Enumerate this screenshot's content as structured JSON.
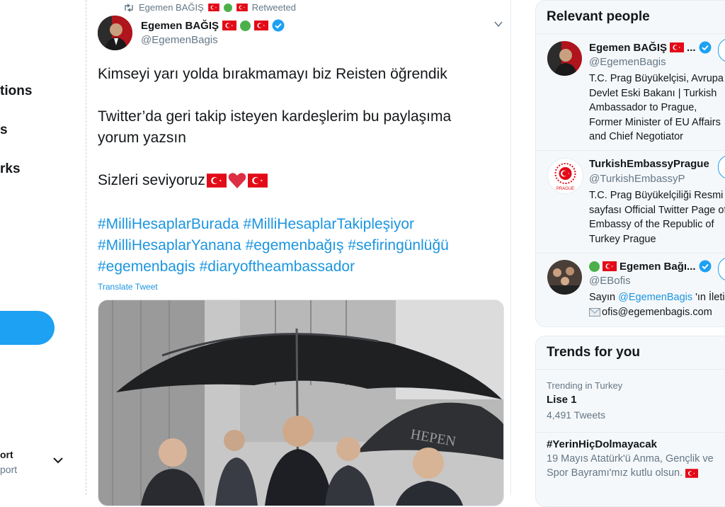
{
  "left_nav": {
    "items": [
      "tions",
      "s",
      "rks"
    ],
    "account_name": "ort",
    "account_handle": "port"
  },
  "tweet": {
    "retweeted_by": "Egemen BAĞIŞ",
    "retweeted_label": "Retweeted",
    "author_name": "Egemen BAĞIŞ",
    "author_handle": "@EgemenBagis",
    "line1": "Kimseyi yarı yolda bırakmamayı biz Reisten öğrendik",
    "line2": "Twitter’da geri takip isteyen kardeşlerim bu paylaşıma yorum yazsın",
    "line3": "Sizleri seviyoruz",
    "hashtags": [
      "#MilliHesaplarBurada",
      "#MilliHesaplarTakipleşiyor",
      "#MilliHesaplarYanana",
      "#egemenbağış",
      "#sefiringünlüğü",
      "#egemenbagis",
      "#diaryoftheambassador"
    ],
    "translate_label": "Translate Tweet",
    "umbrella_text": "HEPEN"
  },
  "relevant_people": {
    "title": "Relevant people",
    "people": [
      {
        "name": "Egemen BAĞIŞ",
        "name_suffix": "...",
        "handle": "@EgemenBagis",
        "bio": "T.C. Prag Büyükelçisi, Avrupa Devlet Eski Bakanı | Turkish Ambassador to Prague, Former Minister of EU Affairs and Chief Negotiator"
      },
      {
        "name": "TurkishEmbassyPrague",
        "handle": "@TurkishEmbassyP",
        "bio": "T.C. Prag Büyükelçiliği Resmi sayfası Official Twitter Page of Embassy of the Republic of Turkey Prague",
        "logo_text": "PRAGUE"
      },
      {
        "name": "Egemen Bağı...",
        "handle": "@EBofis",
        "bio_prefix": "Sayın ",
        "bio_mention": "@EgemenBagis",
        "bio_suffix": " 'ın İletişim",
        "bio_email": "ofis@egemenbagis.com"
      }
    ]
  },
  "trends": {
    "title": "Trends for you",
    "items": [
      {
        "meta": "Trending in Turkey",
        "name": "Lise 1",
        "count": "4,491 Tweets"
      },
      {
        "name": "#YerinHiçDolmayacak",
        "desc": "19 Mayıs Atatürk'ü Anma, Gençlik ve Spor Bayramı'mız kutlu olsun."
      }
    ]
  },
  "colors": {
    "brand_blue": "#1da1f2",
    "link_blue": "#1b95e0",
    "turkey_red": "#e30a17",
    "muted_gray": "#657786"
  }
}
